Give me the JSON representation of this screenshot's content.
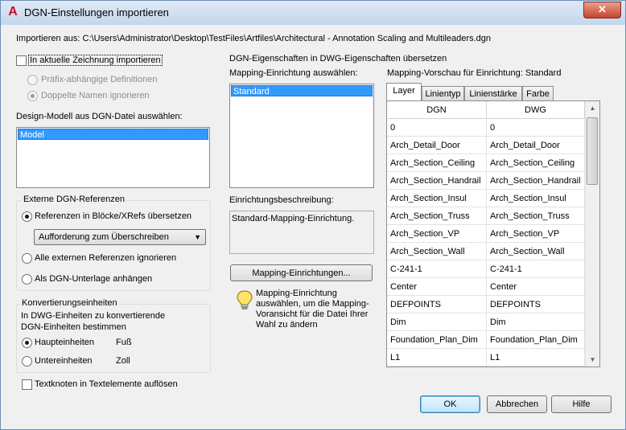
{
  "window": {
    "title": "DGN-Einstellungen importieren",
    "app_icon": "autocad-a-icon",
    "close_label": "✕"
  },
  "import_from": "Importieren aus: C:\\Users\\Administrator\\Desktop\\TestFiles\\Artfiles\\Architectural - Annotation Scaling and Multileaders.dgn",
  "left": {
    "import_current_drawing": {
      "label": "In aktuelle Zeichnung importieren",
      "checked": false
    },
    "prefix_definitions": {
      "label": "Präfix-abhängige Definitionen",
      "selected": false,
      "enabled": false
    },
    "ignore_duplicate_names": {
      "label": "Doppelte Namen ignorieren",
      "selected": true,
      "enabled": false
    },
    "design_model_label": "Design-Modell aus DGN-Datei auswählen:",
    "design_models": [
      "Model"
    ],
    "external_refs": {
      "title": "Externe DGN-Referenzen",
      "translate_option": "Referenzen in Blöcke/XRefs übersetzen",
      "dropdown_value": "Aufforderung zum Überschreiben",
      "ignore_option": "Alle externen Referenzen ignorieren",
      "attach_option": "Als DGN-Unterlage anhängen"
    },
    "conversion_units": {
      "title": "Konvertierungseinheiten",
      "description": "In DWG-Einheiten zu konvertierende DGN-Einheiten bestimmen",
      "master_label": "Haupteinheiten",
      "master_value": "Fuß",
      "sub_label": "Untereinheiten",
      "sub_value": "Zoll"
    },
    "explode_text": {
      "label": "Textknoten in Textelemente auflösen",
      "checked": false
    }
  },
  "middle": {
    "section_title": "DGN-Eigenschaften in DWG-Eigenschaften übersetzen",
    "mapping_select_label": "Mapping-Einrichtung auswählen:",
    "mappings": [
      "Standard"
    ],
    "description_label": "Einrichtungsbeschreibung:",
    "description_text": "Standard-Mapping-Einrichtung.",
    "mapping_button": "Mapping-Einrichtungen...",
    "hint_text": "Mapping-Einrichtung auswählen, um die Mapping-Voransicht für die Datei Ihrer Wahl zu ändern",
    "hint_icon": "lightbulb-icon"
  },
  "right": {
    "preview_label": "Mapping-Vorschau für Einrichtung: Standard",
    "tabs": [
      "Layer",
      "Linientyp",
      "Linienstärke",
      "Farbe"
    ],
    "active_tab": "Layer",
    "columns": [
      "DGN",
      "DWG"
    ],
    "rows": [
      [
        "0",
        "0"
      ],
      [
        "Arch_Detail_Door",
        "Arch_Detail_Door"
      ],
      [
        "Arch_Section_Ceiling",
        "Arch_Section_Ceiling"
      ],
      [
        "Arch_Section_Handrail",
        "Arch_Section_Handrail"
      ],
      [
        "Arch_Section_Insul",
        "Arch_Section_Insul"
      ],
      [
        "Arch_Section_Truss",
        "Arch_Section_Truss"
      ],
      [
        "Arch_Section_VP",
        "Arch_Section_VP"
      ],
      [
        "Arch_Section_Wall",
        "Arch_Section_Wall"
      ],
      [
        "C-241-1",
        "C-241-1"
      ],
      [
        "Center",
        "Center"
      ],
      [
        "DEFPOINTS",
        "DEFPOINTS"
      ],
      [
        "Dim",
        "Dim"
      ],
      [
        "Foundation_Plan_Dim",
        "Foundation_Plan_Dim"
      ],
      [
        "L1",
        "L1"
      ]
    ]
  },
  "buttons": {
    "ok": "OK",
    "cancel": "Abbrechen",
    "help": "Hilfe"
  }
}
